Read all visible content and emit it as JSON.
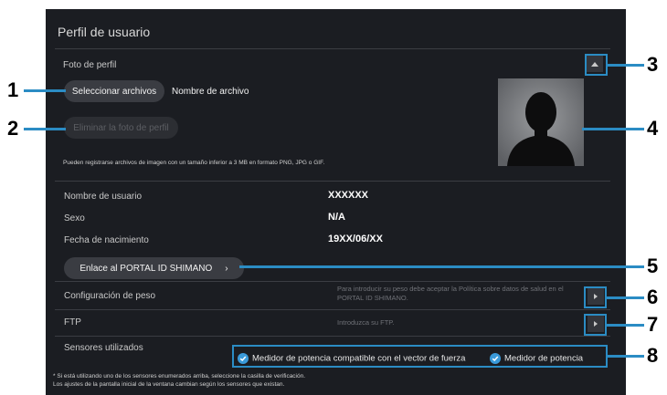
{
  "page": {
    "title": "Perfil de usuario",
    "profile_photo": {
      "label": "Foto de perfil",
      "select_files_label": "Seleccionar archivos",
      "file_name_label": "Nombre de archivo",
      "delete_photo_label": "Eliminar la foto de perfil",
      "note": "Pueden registrarse archivos de imagen con un tamaño inferior a 3 MB en formato PNG, JPG o GIF."
    },
    "user_info": [
      {
        "label": "Nombre de usuario",
        "value": "XXXXXX"
      },
      {
        "label": "Sexo",
        "value": "N/A"
      },
      {
        "label": "Fecha de nacimiento",
        "value": "19XX/06/XX"
      }
    ],
    "portal_link_label": "Enlace al PORTAL ID SHIMANO",
    "weight": {
      "label": "Configuración de peso",
      "hint_line1": "Para introducir su peso debe aceptar la Política sobre datos de salud en el",
      "hint_line2": "PORTAL ID SHIMANO."
    },
    "ftp": {
      "label": "FTP",
      "hint": "Introduzca su FTP."
    },
    "sensors": {
      "label": "Sensores utilizados",
      "options": [
        "Medidor de potencia compatible con el vector de fuerza",
        "Medidor de potencia"
      ],
      "note_line1": "* Si está utilizando uno de los sensores enumerados arriba, seleccione la casilla de verificación.",
      "note_line2": "Los ajustes de la pantalla inicial de la ventana cambian según los sensores que existan."
    }
  },
  "callouts": [
    "1",
    "2",
    "3",
    "4",
    "5",
    "6",
    "7",
    "8"
  ],
  "colors": {
    "panel_bg": "#1b1d22",
    "callout_blue": "#2b8cc4",
    "check_blue": "#3a9ad9"
  }
}
